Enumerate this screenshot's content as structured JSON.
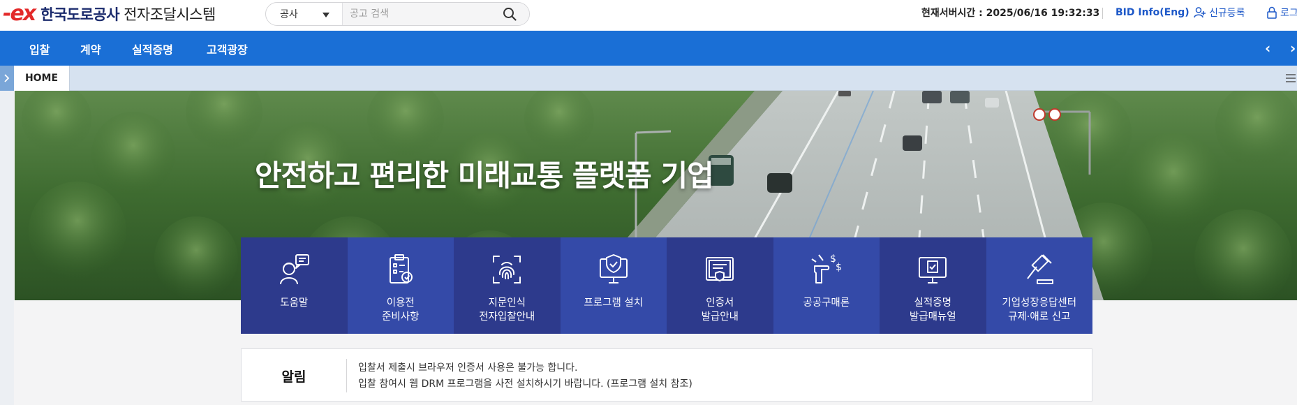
{
  "header": {
    "logo_mark": "ex",
    "org_name": "한국도로공사",
    "system_name": "전자조달시스템",
    "search": {
      "category": "공사",
      "placeholder": "공고 검색"
    },
    "server_time": "현재서버시간 : 2025/06/16 19:32:33",
    "bid_info": "BID Info(Eng)",
    "register": "신규등록",
    "login": "로그"
  },
  "nav": {
    "items": [
      "입찰",
      "계약",
      "실적증명",
      "고객광장"
    ],
    "prev_icon": "chevron-left-icon",
    "next_icon": "chevron-right-icon"
  },
  "tabs": {
    "home": "HOME"
  },
  "hero": {
    "title": "안전하고 편리한 미래교통 플랫폼 기업"
  },
  "quick_menu": [
    {
      "label": "도움말",
      "icon": "help-desk-icon",
      "color": "#2d3a8c"
    },
    {
      "label": "이용전\n준비사항",
      "icon": "checklist-icon",
      "color": "#344aa8"
    },
    {
      "label": "지문인식\n전자입찰안내",
      "icon": "fingerprint-icon",
      "color": "#2d3a8c"
    },
    {
      "label": "프로그램 설치",
      "icon": "monitor-shield-icon",
      "color": "#344aa8"
    },
    {
      "label": "인증서\n발급안내",
      "icon": "certificate-icon",
      "color": "#2d3a8c"
    },
    {
      "label": "공공구매론",
      "icon": "loan-hand-icon",
      "color": "#344aa8"
    },
    {
      "label": "실적증명\n발급매뉴얼",
      "icon": "monitor-doc-icon",
      "color": "#2d3a8c"
    },
    {
      "label": "기업성장응답센터\n규제·애로 신고",
      "icon": "gavel-icon",
      "color": "#344aa8"
    }
  ],
  "notice": {
    "title": "알림",
    "lines": [
      "입찰서 제출시 브라우저 인증서 사용은 불가능 합니다.",
      "입찰 참여시 웹 DRM 프로그램을 사전 설치하시기 바랍니다. (프로그램 설치 참조)"
    ]
  },
  "colors": {
    "nav_blue": "#1a6fd6",
    "tile_dark": "#2d3a8c",
    "tile_light": "#344aa8",
    "logo_red": "#e32a2a",
    "link_blue": "#1d58c8"
  }
}
